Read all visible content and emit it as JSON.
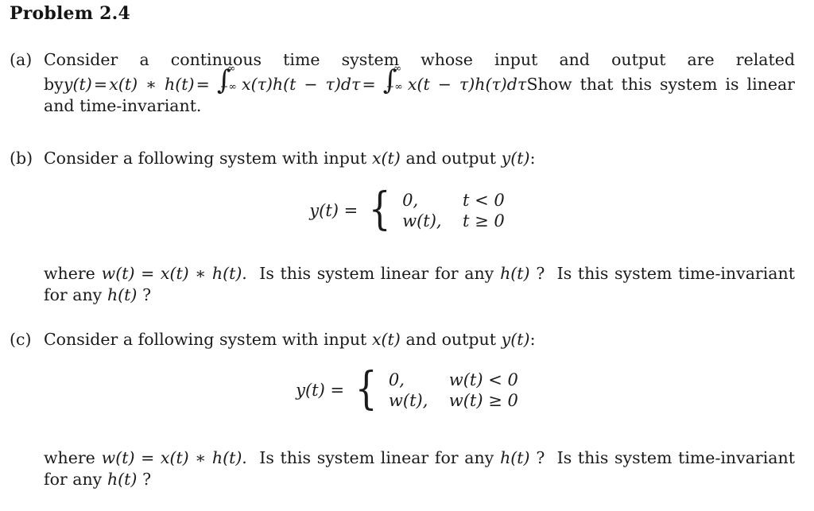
{
  "document": {
    "title": "Problem 2.4"
  },
  "items": [
    {
      "label": "(a)",
      "text_part1": "Consider a continuous time system whose input and output are related by",
      "math_y": "y(t)",
      "eq1": "=",
      "math_conv": "x(t) ∗ h(t)",
      "eq2": "=",
      "integrand1": "x(τ)h(t − τ)dτ",
      "eq3": "=",
      "integrand2": "x(t − τ)h(τ)dτ",
      "integral_upper": "∞",
      "integral_lower": "−∞",
      "text_part2": "Show that this system is linear and time-invariant."
    },
    {
      "label": "(b)",
      "intro_prefix": "Consider a following system with input",
      "intro_x": "x(t)",
      "intro_mid": "and output",
      "intro_y": "y(t)",
      "intro_suffix": ":",
      "equation": {
        "lhs": "y(t) =",
        "rows": [
          {
            "value": "0,",
            "condition": "t < 0"
          },
          {
            "value": "w(t),",
            "condition": "t ≥ 0"
          }
        ]
      },
      "where_prefix": "where",
      "where_def": "w(t) = x(t) ∗ h(t).",
      "q1_prefix": "Is this system linear for any",
      "q1_h": "h(t)",
      "q1_suffix": "?",
      "q2": "Is this system time-invariant for any",
      "q2_h": "h(t)",
      "q2_suffix": "?"
    },
    {
      "label": "(c)",
      "intro_prefix": "Consider a following system with input",
      "intro_x": "x(t)",
      "intro_mid": "and output",
      "intro_y": "y(t)",
      "intro_suffix": ":",
      "equation": {
        "lhs": "y(t) =",
        "rows": [
          {
            "value": "0,",
            "condition": "w(t) < 0"
          },
          {
            "value": "w(t),",
            "condition": "w(t) ≥ 0"
          }
        ]
      },
      "where_prefix": "where",
      "where_def": "w(t) = x(t) ∗ h(t).",
      "q1_prefix": "Is this system linear for any",
      "q1_h": "h(t)",
      "q1_suffix": "?",
      "q2": "Is this system time-invariant for any",
      "q2_h": "h(t)",
      "q2_suffix": "?"
    }
  ],
  "colors": {
    "text": "#1b1b1b",
    "background": "#ffffff"
  }
}
